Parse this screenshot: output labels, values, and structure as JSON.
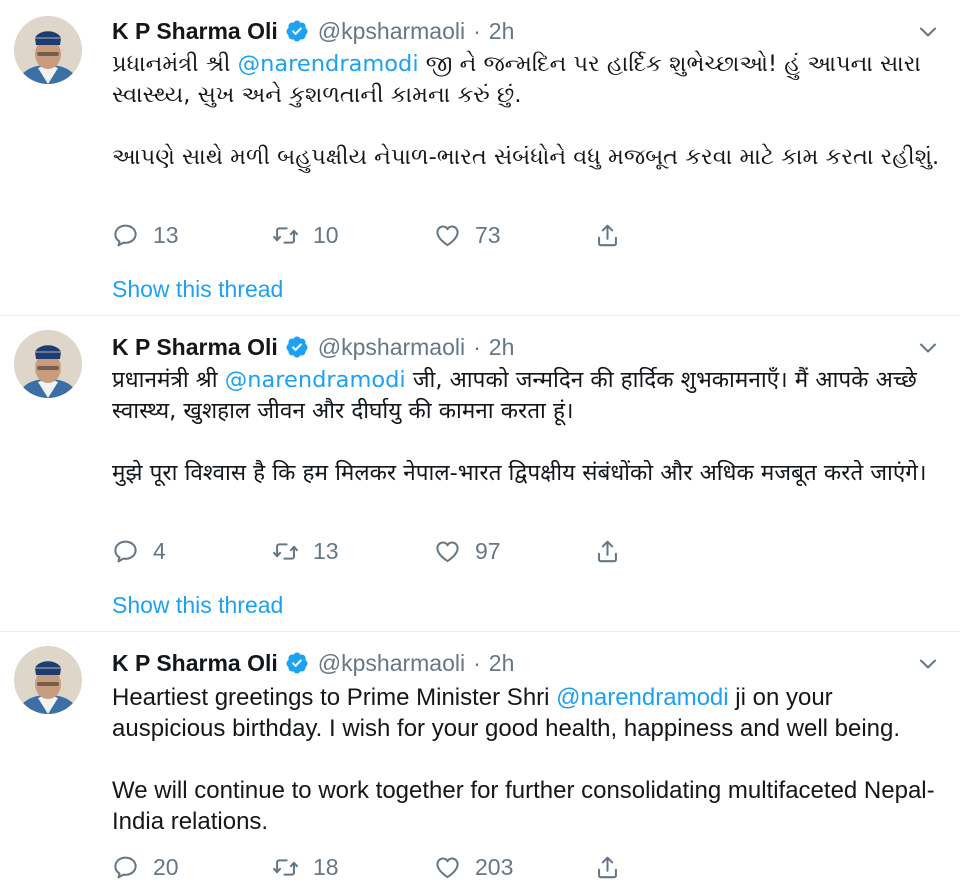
{
  "tweets": [
    {
      "author_name": "K P Sharma Oli",
      "handle": "@kpsharmaoli",
      "separator": "·",
      "time": "2h",
      "lang": "gu",
      "p1_before": "પ્રધાનમંત્રી શ્રી ",
      "mention": "@narendramodi",
      "p1_after": " જી ને જન્મદિન પર હાર્દિક શુભેચ્છાઓ! હું આપના સારા સ્વાસ્થ્ય, સુખ અને કુશળતાની કામના કરું છું.",
      "p2": "આપણે સાથે મળી બહુપક્ષીય નેપાળ-ભારત સંબંધોને વધુ મજબૂત કરવા માટે કામ કરતા રહીશું.",
      "replies": "13",
      "retweets": "10",
      "likes": "73",
      "show_thread": "Show this thread"
    },
    {
      "author_name": "K P Sharma Oli",
      "handle": "@kpsharmaoli",
      "separator": "·",
      "time": "2h",
      "lang": "hi",
      "p1_before": "प्रधानमंत्री श्री ",
      "mention": "@narendramodi",
      "p1_after": " जी, आपको जन्मदिन की हार्दिक शुभकामनाएँ। मैं आपके अच्छे स्वास्थ्य, खुशहाल जीवन और दीर्घायु की कामना करता हूं।",
      "p2": "मुझे पूरा विश्वास है कि हम मिलकर नेपाल-भारत द्विपक्षीय संबंधोंको और अधिक मजबूत करते जाएंगे।",
      "replies": "4",
      "retweets": "13",
      "likes": "97",
      "show_thread": "Show this thread"
    },
    {
      "author_name": "K P Sharma Oli",
      "handle": "@kpsharmaoli",
      "separator": "·",
      "time": "2h",
      "lang": "en",
      "p1_before": "Heartiest greetings to Prime Minister Shri ",
      "mention": "@narendramodi",
      "p1_after": " ji on your auspicious birthday. I wish for your good health, happiness and well being.",
      "p2": "We will continue to work together for further consolidating multifaceted Nepal-India relations.",
      "replies": "20",
      "retweets": "18",
      "likes": "203"
    }
  ],
  "colors": {
    "link": "#1da1f2",
    "muted": "#657786",
    "text": "#14171a",
    "divider": "#e6ecf0"
  },
  "icons": [
    "verified-badge-icon",
    "chevron-down-icon",
    "reply-icon",
    "retweet-icon",
    "like-icon",
    "share-icon"
  ]
}
